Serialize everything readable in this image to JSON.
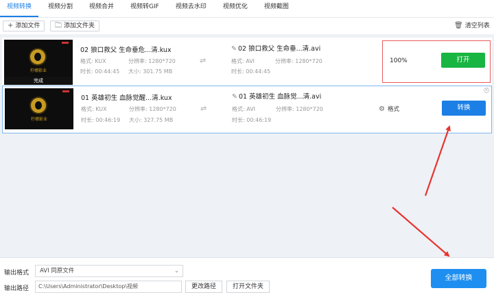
{
  "tabs": [
    {
      "label": "视频转换",
      "active": true
    },
    {
      "label": "视频分割"
    },
    {
      "label": "视频合并"
    },
    {
      "label": "视频转GIF"
    },
    {
      "label": "视频去水印"
    },
    {
      "label": "视频优化"
    },
    {
      "label": "视频截图"
    }
  ],
  "toolbar": {
    "add_file": "添加文件",
    "add_folder": "添加文件夹",
    "clear_list": "清空列表"
  },
  "items": [
    {
      "thumb_text": "柠檬影业",
      "status_label": "完成",
      "source_name": "02 狼口救父 生命垂危...清.kux",
      "source_format_label": "格式:",
      "source_format": "KUX",
      "source_res_label": "分辨率:",
      "source_res": "1280*720",
      "source_dur_label": "时长:",
      "source_dur": "00:44:45",
      "source_size_label": "大小:",
      "source_size": "301.75 MB",
      "target_name": "02 狼口救父 生命垂...清.avi",
      "target_format_label": "格式:",
      "target_format": "AVI",
      "target_res_label": "分辨率:",
      "target_res": "1280*720",
      "target_dur_label": "时长:",
      "target_dur": "00:44:45",
      "progress": "100%",
      "action": "打开"
    },
    {
      "thumb_text": "柠檬影业",
      "source_name": "01 英雄初生 血脉觉醒...清.kux",
      "source_format_label": "格式:",
      "source_format": "KUX",
      "source_res_label": "分辨率:",
      "source_res": "1280*720",
      "source_dur_label": "时长:",
      "source_dur": "00:46:19",
      "source_size_label": "大小:",
      "source_size": "327.75 MB",
      "target_name": "01 英雄初生 血脉觉...清.avi",
      "target_format_label": "格式:",
      "target_format": "AVI",
      "target_res_label": "分辨率:",
      "target_res": "1280*720",
      "target_dur_label": "时长:",
      "target_dur": "00:46:19",
      "settings_label": "格式",
      "action": "转换"
    }
  ],
  "bottom": {
    "output_format_label": "输出格式",
    "output_format_value": "AVI  同原文件",
    "output_path_label": "输出路径",
    "output_path_value": "C:\\Users\\Administrator\\Desktop\\视频",
    "change_path": "更改路径",
    "open_folder": "打开文件夹",
    "convert_all": "全部转换"
  },
  "colors": {
    "accent": "#1b7fe5",
    "open_button": "#19b542",
    "annotation": "#e8332f"
  }
}
